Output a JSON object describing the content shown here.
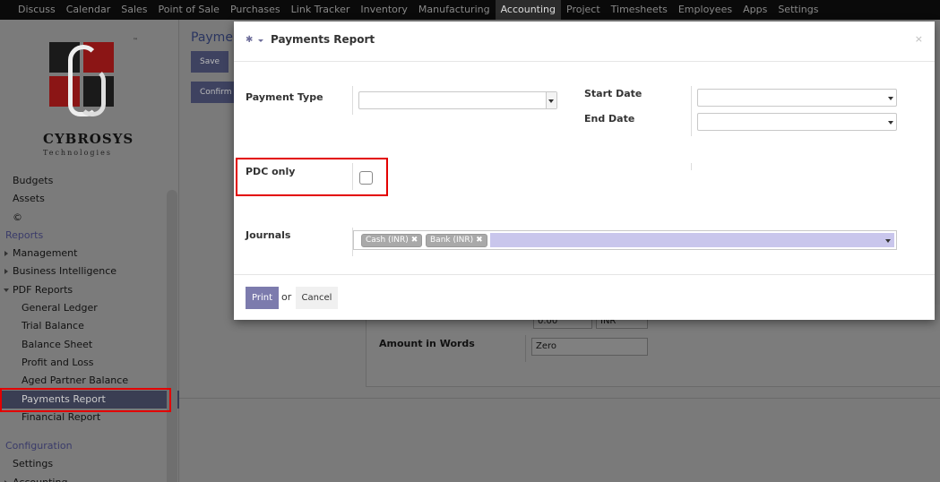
{
  "topbar": {
    "items": [
      "Discuss",
      "Calendar",
      "Sales",
      "Point of Sale",
      "Purchases",
      "Link Tracker",
      "Inventory",
      "Manufacturing",
      "Accounting",
      "Project",
      "Timesheets",
      "Employees",
      "Apps",
      "Settings"
    ],
    "active": "Accounting"
  },
  "logo": {
    "name": "CYBROSYS",
    "sub": "Technologies",
    "tm": "™"
  },
  "sidebar": {
    "budgets": "Budgets",
    "assets": "Assets",
    "copyright": "©",
    "reports_header": "Reports",
    "management": "Management",
    "business_intelligence": "Business Intelligence",
    "pdf_reports": "PDF Reports",
    "general_ledger": "General Ledger",
    "trial_balance": "Trial Balance",
    "balance_sheet": "Balance Sheet",
    "profit_loss": "Profit and Loss",
    "aged_partner": "Aged Partner Balance",
    "payments_report": "Payments Report",
    "financial_report": "Financial Report",
    "configuration_header": "Configuration",
    "settings": "Settings",
    "accounting": "Accounting"
  },
  "background": {
    "title": "Paymen",
    "save": "Save",
    "confirm": "Confirm",
    "amount_in_words_label": "Amount in Words",
    "amount_in_words_value": "Zero",
    "amount_value": "0.00",
    "currency": "INR"
  },
  "modal": {
    "title": "Payments Report",
    "close": "×",
    "payment_type_label": "Payment Type",
    "start_date_label": "Start Date",
    "end_date_label": "End Date",
    "pdc_only_label": "PDC only",
    "pdc_only_checked": false,
    "journals_label": "Journals",
    "journals": [
      "Cash (INR)",
      "Bank (INR)"
    ],
    "print": "Print",
    "or": "or",
    "cancel": "Cancel"
  },
  "colors": {
    "highlight": "#e30000",
    "primary_button": "#7c7bad",
    "journals_fill": "#c9c6ec"
  }
}
